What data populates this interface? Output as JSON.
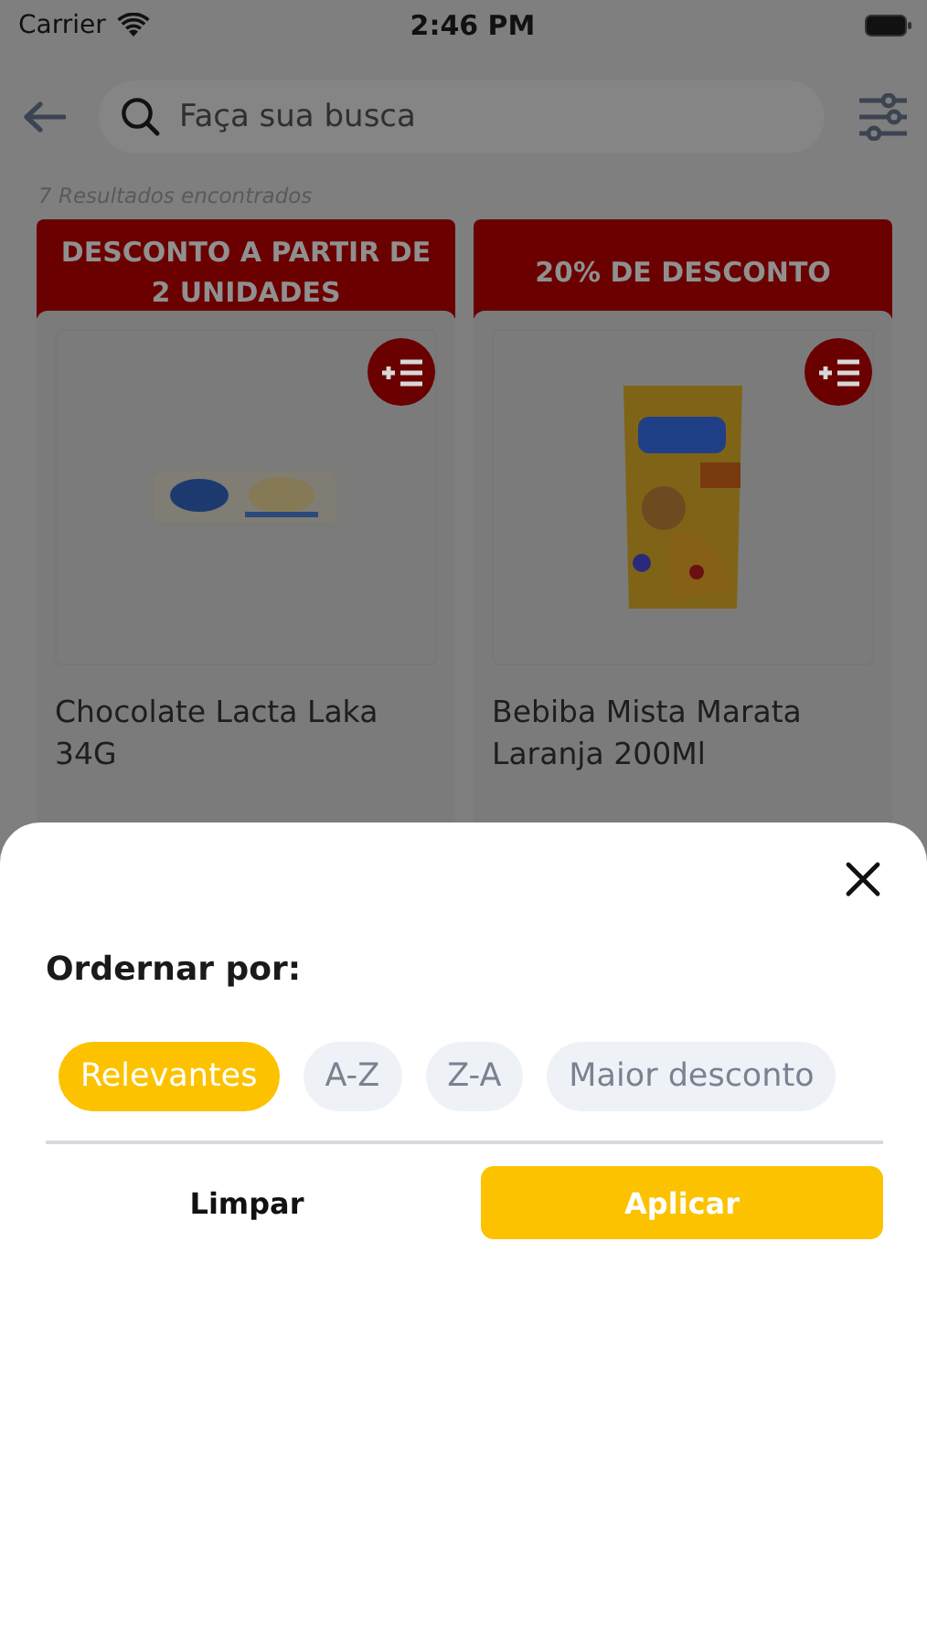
{
  "status_bar": {
    "carrier": "Carrier",
    "time": "2:46 PM"
  },
  "search": {
    "placeholder": "Faça sua busca"
  },
  "results_count": "7 Resultados encontrados",
  "products": [
    {
      "banner": "DESCONTO A PARTIR DE 2 UNIDADES",
      "name": "Chocolate Lacta Laka 34G"
    },
    {
      "banner": "20% DE DESCONTO",
      "name": "Bebiba Mista Marata Laranja 200Ml"
    }
  ],
  "sort_sheet": {
    "title": "Ordernar por:",
    "options": [
      {
        "label": "Relevantes",
        "selected": true
      },
      {
        "label": "A-Z",
        "selected": false
      },
      {
        "label": "Z-A",
        "selected": false
      },
      {
        "label": "Maior desconto",
        "selected": false
      }
    ],
    "buttons": [
      {
        "label": "Limpar",
        "kind": "plain"
      },
      {
        "label": "Aplicar",
        "kind": "primary"
      }
    ]
  }
}
